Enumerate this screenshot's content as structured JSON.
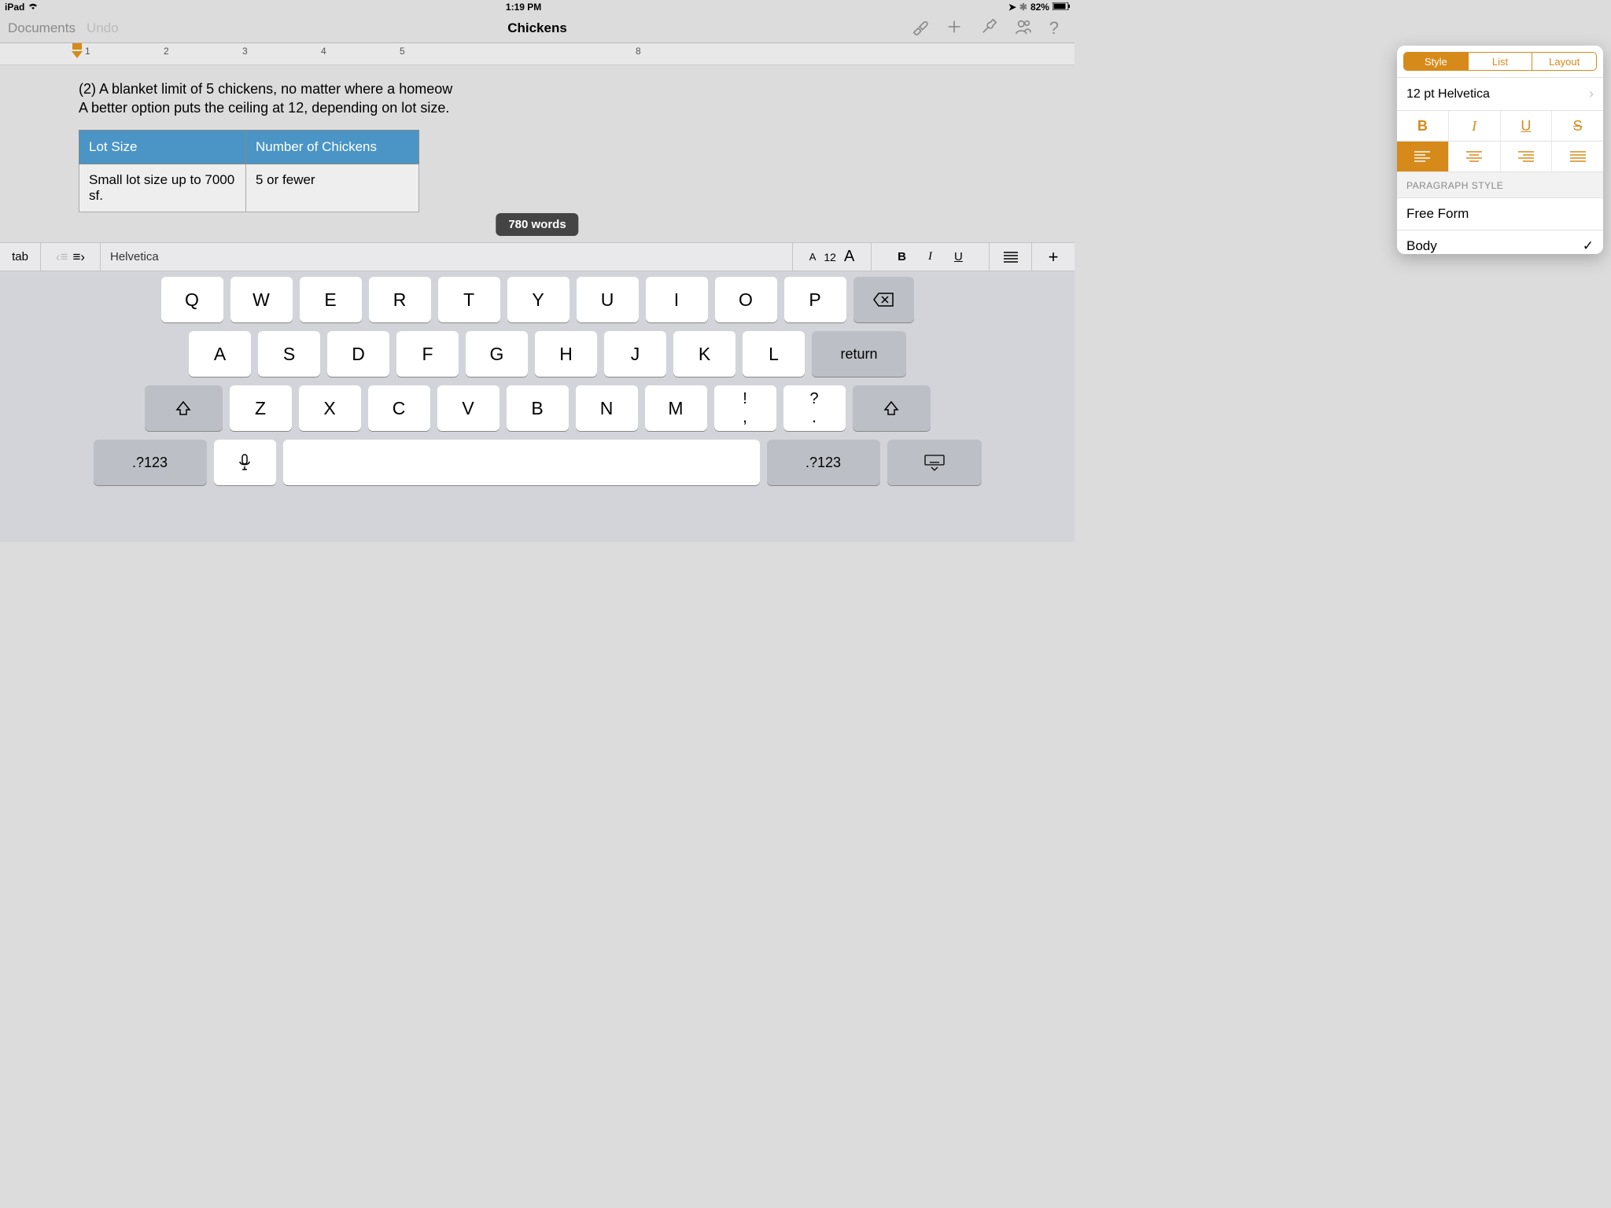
{
  "status": {
    "device": "iPad",
    "time": "1:19 PM",
    "battery": "82%"
  },
  "toolbar": {
    "documents": "Documents",
    "undo": "Undo",
    "title": "Chickens"
  },
  "ruler": {
    "numbers": [
      "1",
      "2",
      "3",
      "4",
      "5",
      "8"
    ]
  },
  "document": {
    "line1": "(2) A blanket limit of 5 chickens, no matter where a homeow",
    "line2": "A better option puts the ceiling at 12, depending on lot size.",
    "headers": [
      "Lot Size",
      "Number of Chickens"
    ],
    "row": [
      "Small lot size up to 7000 sf.",
      "5 or fewer"
    ],
    "wordcount": "780 words"
  },
  "popover": {
    "tabs": [
      "Style",
      "List",
      "Layout"
    ],
    "font": "12 pt Helvetica",
    "bold": "B",
    "italic": "I",
    "underline": "U",
    "strike": "S",
    "section": "PARAGRAPH STYLE",
    "style1": "Free Form",
    "style2": "Body"
  },
  "shortcutbar": {
    "tab": "tab",
    "font": "Helvetica",
    "sizeSmall": "A",
    "sizeNum": "12",
    "sizeBig": "A",
    "bold": "B",
    "italic": "I",
    "underline": "U",
    "plus": "+"
  },
  "keyboard": {
    "row1": [
      "Q",
      "W",
      "E",
      "R",
      "T",
      "Y",
      "U",
      "I",
      "O",
      "P"
    ],
    "row2": [
      "A",
      "S",
      "D",
      "F",
      "G",
      "H",
      "J",
      "K",
      "L"
    ],
    "row3": [
      "Z",
      "X",
      "C",
      "V",
      "B",
      "N",
      "M"
    ],
    "punct1top": "!",
    "punct1bot": ",",
    "punct2top": "?",
    "punct2bot": ".",
    "return": "return",
    "num": ".?123"
  }
}
